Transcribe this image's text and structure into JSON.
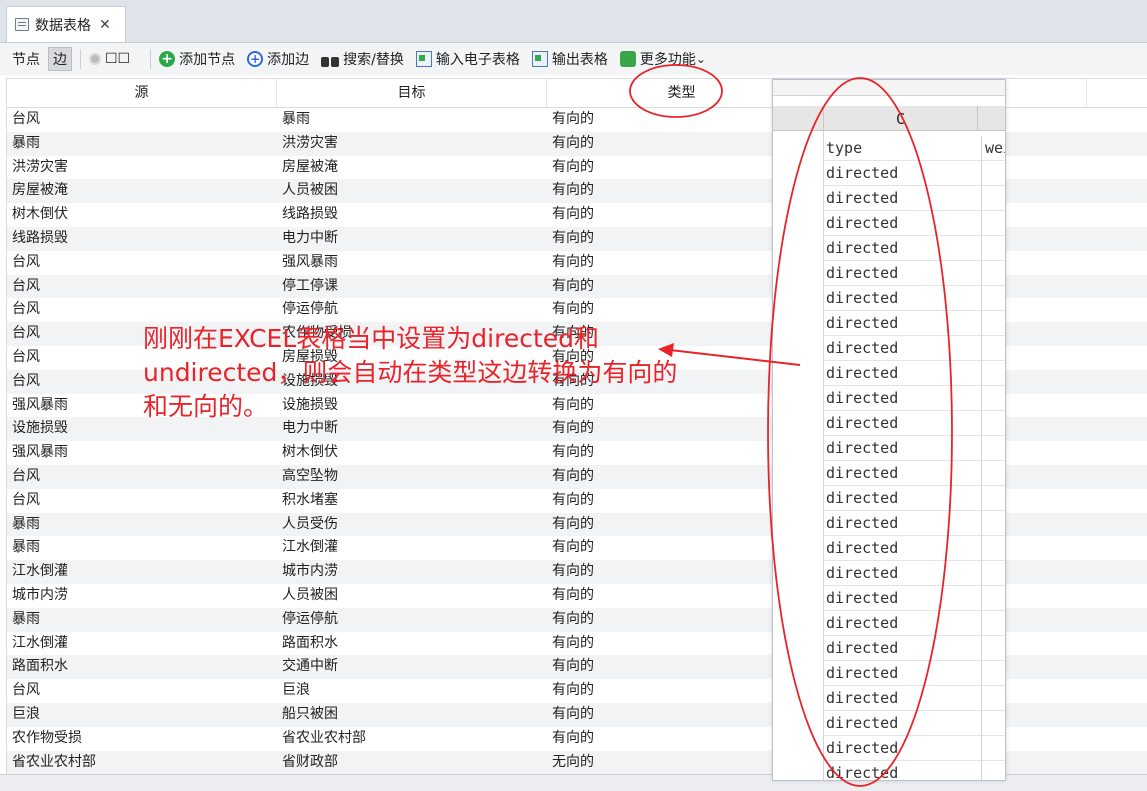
{
  "tab": {
    "label": "数据表格",
    "close": "✕"
  },
  "toolbar": {
    "nodes": "节点",
    "edges": "边",
    "boxes": "☐☐",
    "add_node": "添加节点",
    "add_edge": "添加边",
    "search_replace": "搜索/替换",
    "import_spreadsheet": "输入电子表格",
    "export_table": "输出表格",
    "more": "更多功能",
    "more_chevron": "⌄"
  },
  "table": {
    "headers": [
      "源",
      "目标",
      "类型"
    ],
    "rows": [
      [
        "台风",
        "暴雨",
        "有向的"
      ],
      [
        "暴雨",
        "洪涝灾害",
        "有向的"
      ],
      [
        "洪涝灾害",
        "房屋被淹",
        "有向的"
      ],
      [
        "房屋被淹",
        "人员被困",
        "有向的"
      ],
      [
        "树木倒伏",
        "线路损毁",
        "有向的"
      ],
      [
        "线路损毁",
        "电力中断",
        "有向的"
      ],
      [
        "台风",
        "强风暴雨",
        "有向的"
      ],
      [
        "台风",
        "停工停课",
        "有向的"
      ],
      [
        "台风",
        "停运停航",
        "有向的"
      ],
      [
        "台风",
        "农作物受损",
        "有向的"
      ],
      [
        "台风",
        "房屋损毁",
        "有向的"
      ],
      [
        "台风",
        "设施损毁",
        "有向的"
      ],
      [
        "强风暴雨",
        "设施损毁",
        "有向的"
      ],
      [
        "设施损毁",
        "电力中断",
        "有向的"
      ],
      [
        "强风暴雨",
        "树木倒伏",
        "有向的"
      ],
      [
        "台风",
        "高空坠物",
        "有向的"
      ],
      [
        "台风",
        "积水堵塞",
        "有向的"
      ],
      [
        "暴雨",
        "人员受伤",
        "有向的"
      ],
      [
        "暴雨",
        "江水倒灌",
        "有向的"
      ],
      [
        "江水倒灌",
        "城市内涝",
        "有向的"
      ],
      [
        "城市内涝",
        "人员被困",
        "有向的"
      ],
      [
        "暴雨",
        "停运停航",
        "有向的"
      ],
      [
        "江水倒灌",
        "路面积水",
        "有向的"
      ],
      [
        "路面积水",
        "交通中断",
        "有向的"
      ],
      [
        "台风",
        "巨浪",
        "有向的"
      ],
      [
        "巨浪",
        "船只被困",
        "有向的"
      ],
      [
        "农作物受损",
        "省农业农村部",
        "有向的"
      ],
      [
        "省农业农村部",
        "省财政部",
        "无向的"
      ]
    ]
  },
  "excel": {
    "column_letter": "C",
    "header_value": "type",
    "next_header": "wei",
    "values": [
      "directed",
      "directed",
      "directed",
      "directed",
      "directed",
      "directed",
      "directed",
      "directed",
      "directed",
      "directed",
      "directed",
      "directed",
      "directed",
      "directed",
      "directed",
      "directed",
      "directed",
      "directed",
      "directed",
      "directed",
      "directed",
      "directed",
      "directed",
      "directed",
      "directed",
      "directed"
    ]
  },
  "annotation": {
    "text": "刚刚在EXCEL表格当中设置为directed和undirected，则会自动在类型这边转换为有向的和无向的。",
    "color": "#e8242a"
  }
}
